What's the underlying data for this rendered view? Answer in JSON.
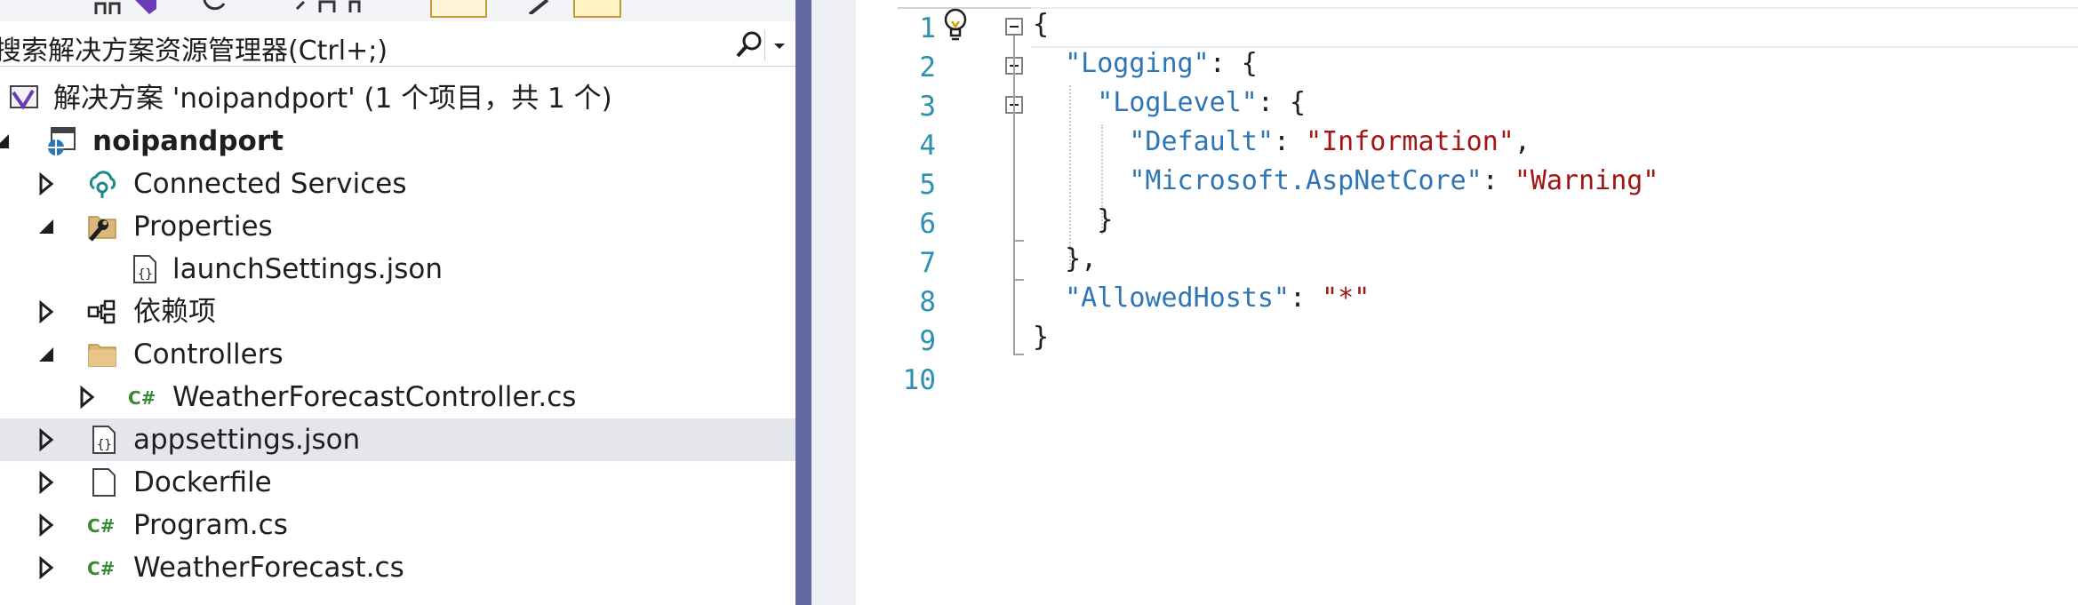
{
  "explorer": {
    "search_placeholder": "搜索解决方案资源管理器(Ctrl+;)",
    "solution_label": "解决方案 'noipandport' (1 个项目，共 1 个)",
    "project_label": "noipandport",
    "items": [
      {
        "label": "Connected Services",
        "icon": "connected-services-icon",
        "expander": "collapsed"
      },
      {
        "label": "Properties",
        "icon": "properties-folder-icon",
        "expander": "expanded"
      },
      {
        "label": "launchSettings.json",
        "icon": "json-file-icon",
        "expander": "none"
      },
      {
        "label": "依赖项",
        "icon": "dependencies-icon",
        "expander": "collapsed"
      },
      {
        "label": "Controllers",
        "icon": "folder-icon",
        "expander": "expanded"
      },
      {
        "label": "WeatherForecastController.cs",
        "icon": "csharp-file-icon",
        "expander": "collapsed"
      },
      {
        "label": "appsettings.json",
        "icon": "json-file-icon",
        "expander": "collapsed",
        "selected": true
      },
      {
        "label": "Dockerfile",
        "icon": "file-icon",
        "expander": "collapsed"
      },
      {
        "label": "Program.cs",
        "icon": "csharp-file-icon",
        "expander": "collapsed"
      },
      {
        "label": "WeatherForecast.cs",
        "icon": "csharp-file-icon",
        "expander": "collapsed"
      }
    ]
  },
  "editor": {
    "line_numbers": [
      "1",
      "2",
      "3",
      "4",
      "5",
      "6",
      "7",
      "8",
      "9",
      "10"
    ],
    "lines": [
      [
        {
          "t": "pun",
          "v": "{"
        }
      ],
      [
        {
          "t": "pun",
          "v": "  "
        },
        {
          "t": "key",
          "v": "\"Logging\""
        },
        {
          "t": "pun",
          "v": ": {"
        }
      ],
      [
        {
          "t": "pun",
          "v": "    "
        },
        {
          "t": "key",
          "v": "\"LogLevel\""
        },
        {
          "t": "pun",
          "v": ": {"
        }
      ],
      [
        {
          "t": "pun",
          "v": "      "
        },
        {
          "t": "key",
          "v": "\"Default\""
        },
        {
          "t": "pun",
          "v": ": "
        },
        {
          "t": "str",
          "v": "\"Information\""
        },
        {
          "t": "pun",
          "v": ","
        }
      ],
      [
        {
          "t": "pun",
          "v": "      "
        },
        {
          "t": "key",
          "v": "\"Microsoft.AspNetCore\""
        },
        {
          "t": "pun",
          "v": ": "
        },
        {
          "t": "str",
          "v": "\"Warning\""
        }
      ],
      [
        {
          "t": "pun",
          "v": "    }"
        }
      ],
      [
        {
          "t": "pun",
          "v": "  },"
        }
      ],
      [
        {
          "t": "pun",
          "v": "  "
        },
        {
          "t": "key",
          "v": "\"AllowedHosts\""
        },
        {
          "t": "pun",
          "v": ": "
        },
        {
          "t": "str",
          "v": "\"*\""
        }
      ],
      [
        {
          "t": "pun",
          "v": "}"
        }
      ],
      []
    ]
  },
  "colors": {
    "splitter": "#646aa0",
    "selection": "#e5e6eb",
    "line_number": "#2b91af",
    "json_key": "#2e75b6",
    "json_string": "#a31515"
  }
}
